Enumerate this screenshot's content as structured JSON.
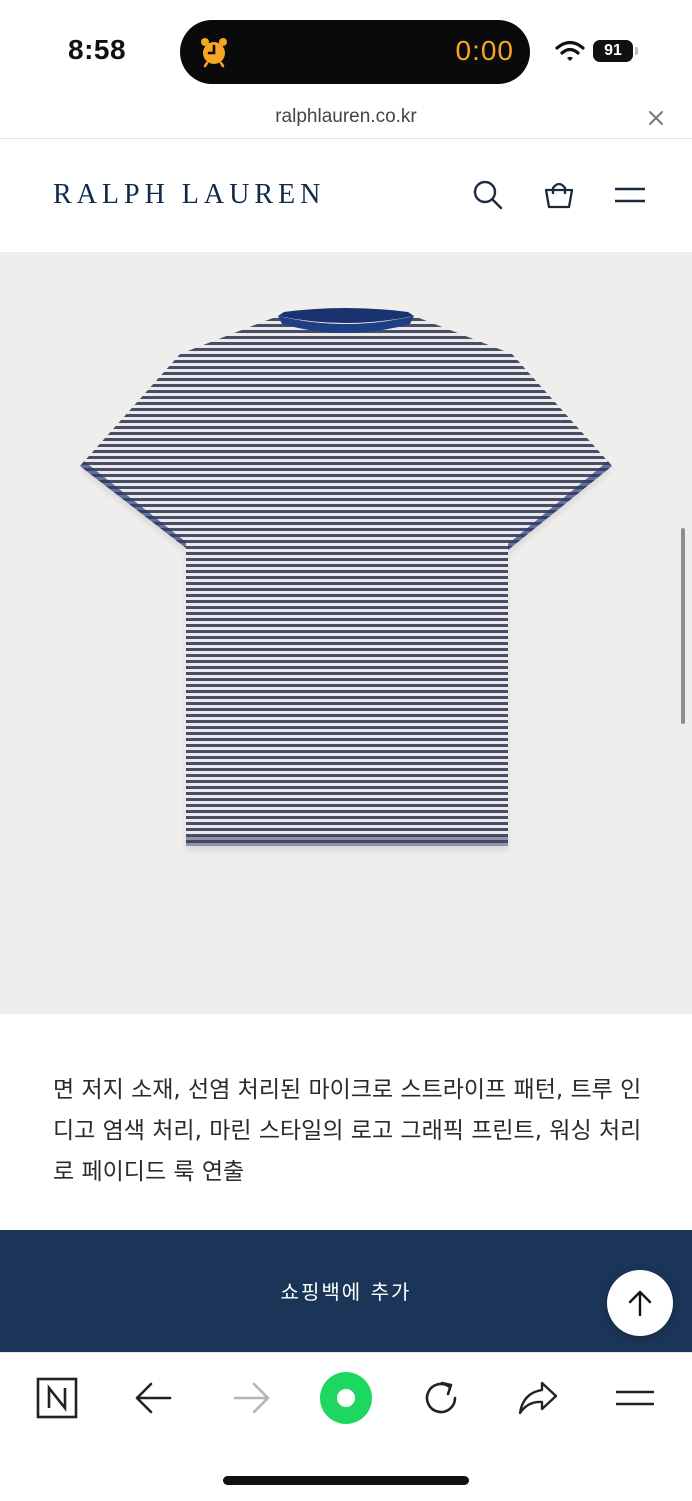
{
  "status_bar": {
    "time": "8:58",
    "timer": "0:00",
    "battery": "91",
    "icons": [
      "alarm-clock-icon",
      "wifi-icon",
      "battery-icon"
    ]
  },
  "browser": {
    "url": "ralphlauren.co.kr"
  },
  "header": {
    "logo": "RALPH LAUREN",
    "icons": [
      "search-icon",
      "shopping-bag-icon",
      "menu-icon"
    ]
  },
  "product": {
    "image_alt": "striped short-sleeve t-shirt back view",
    "description": "면 저지 소재, 선염 처리된 마이크로 스트라이프 패턴, 트루 인디고 염색 처리, 마린 스타일의 로고 그래픽 프린트, 워싱 처리로 페이디드 룩 연출",
    "add_to_bag_label": "쇼핑백에  추가"
  },
  "toolbar": {
    "icons": [
      "naver-n-icon",
      "back-arrow-icon",
      "forward-arrow-icon",
      "green-dot-icon",
      "reload-icon",
      "share-icon",
      "menu-icon"
    ]
  },
  "colors": {
    "brand_navy": "#1b3558",
    "logo_navy": "#0f2a4a",
    "timer_orange": "#f5a623",
    "green_button": "#1ed760",
    "image_bg": "#efeeec"
  }
}
